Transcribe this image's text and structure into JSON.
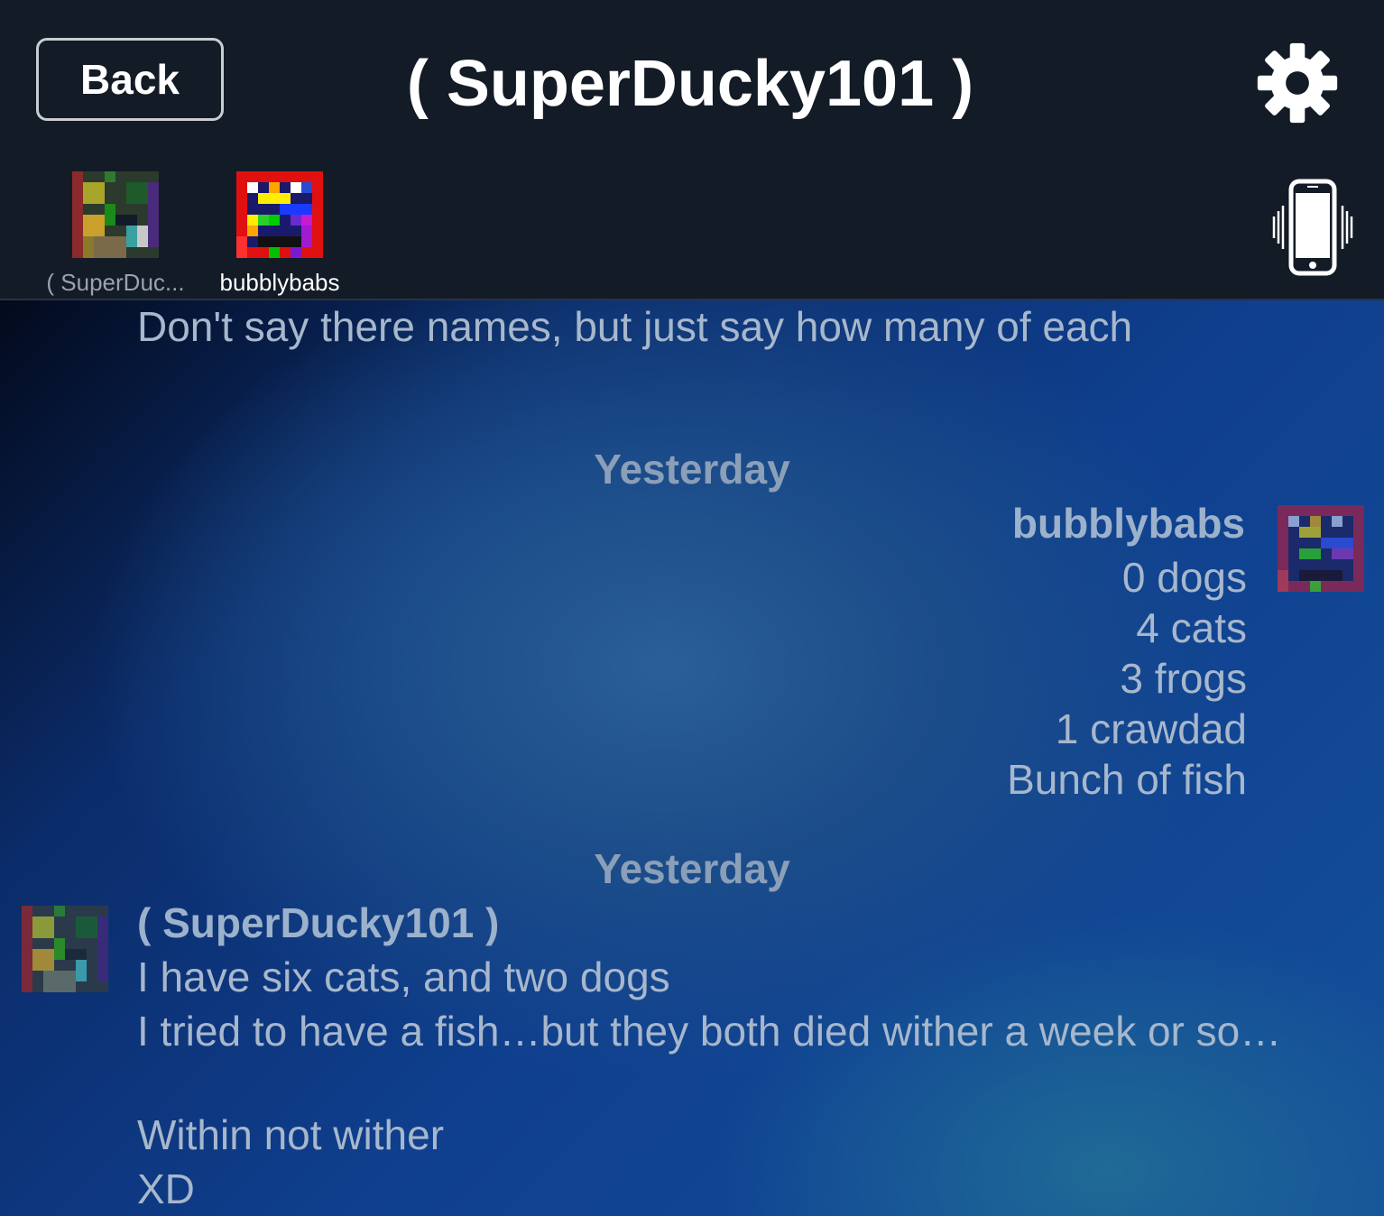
{
  "header": {
    "back_label": "Back",
    "title": "( SuperDucky101 )",
    "settings_icon": "gear-icon",
    "vibrate_icon": "phone-vibrate-icon"
  },
  "participants": [
    {
      "name": "( SuperDuc...",
      "avatar": "pixel-avatar-green"
    },
    {
      "name": "bubblybabs",
      "avatar": "pixel-avatar-rainbow"
    }
  ],
  "chat": {
    "top_message": "Don't say there names, but just say how many of each",
    "groups": [
      {
        "date": "Yesterday",
        "sender": "bubblybabs",
        "lines": [
          "0 dogs",
          "4 cats",
          "3 frogs",
          "1 crawdad",
          "Bunch of fish"
        ]
      },
      {
        "date": "Yesterday",
        "sender": "( SuperDucky101 )",
        "lines": [
          "I have six cats, and two dogs",
          "I tried to have a fish…but they both died wither a week or so…",
          "",
          "Within not wither",
          "XD"
        ]
      }
    ]
  },
  "colors": {
    "header_bg": "#131b27",
    "chat_text": "#a7b7cc",
    "date_text": "#8b9fb9"
  }
}
